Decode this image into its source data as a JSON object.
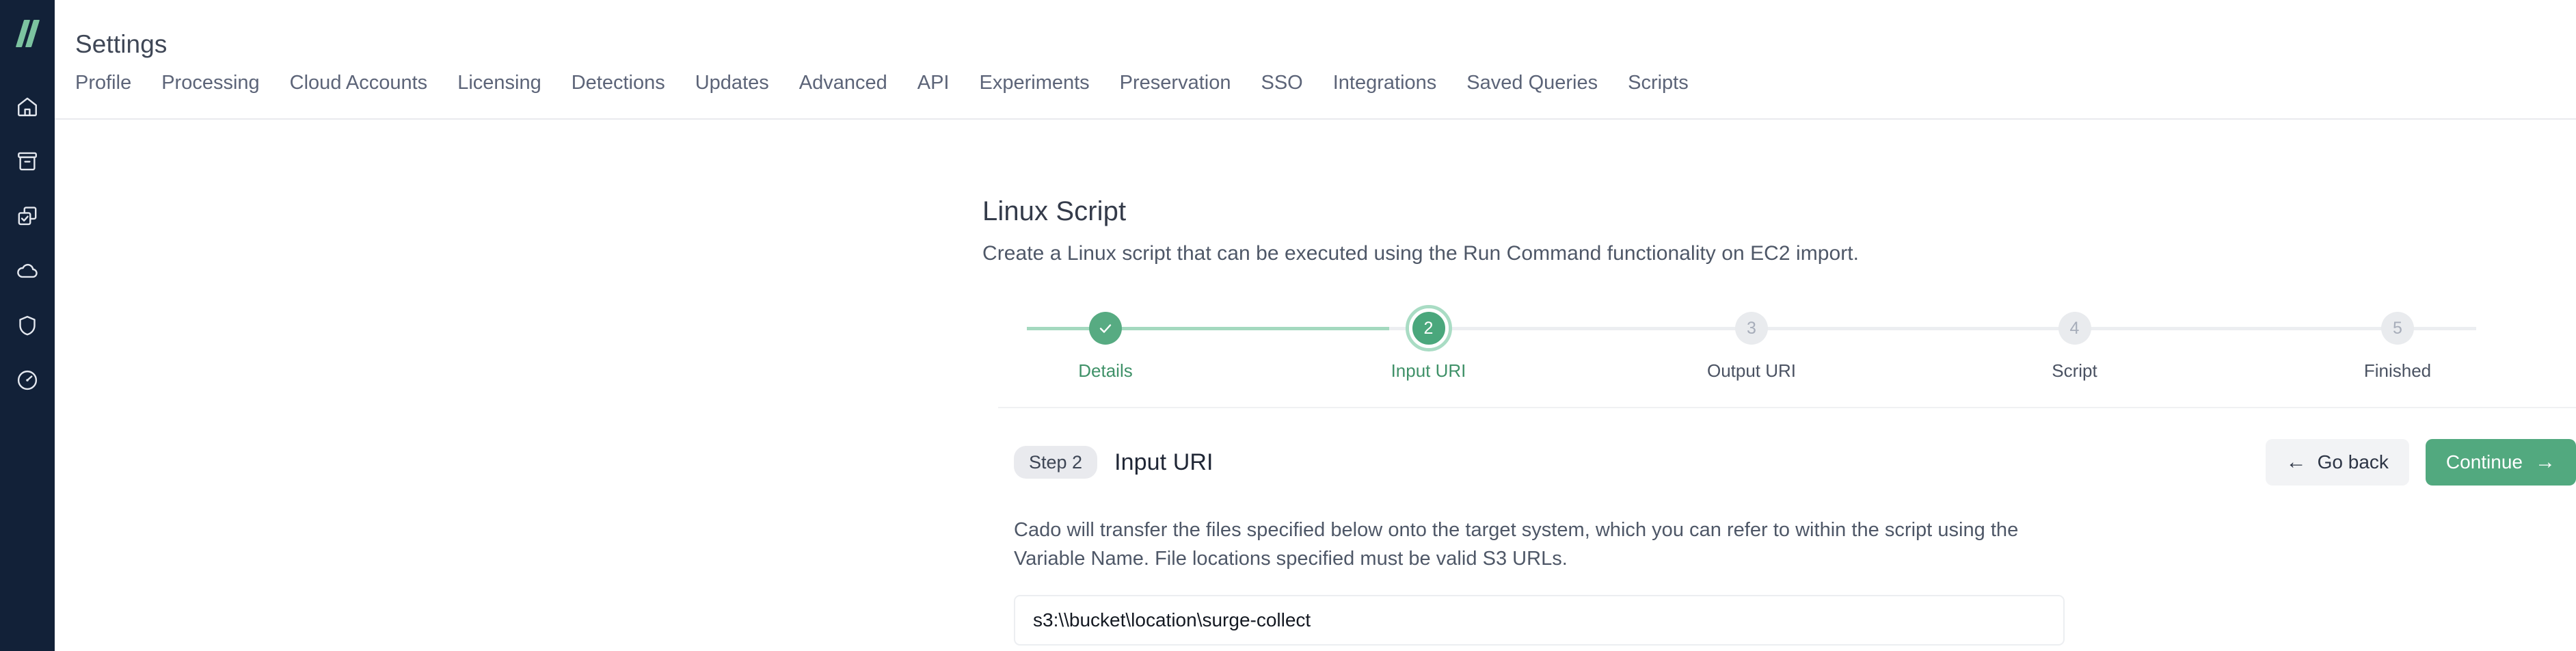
{
  "brand": {
    "logo_name": "cado-logo",
    "sidebar_bg": "#122138",
    "accent_green": "#7cc3a0",
    "primary_green": "#52a97f"
  },
  "sidebar": {
    "items": [
      {
        "icon": "home-icon",
        "name": "sidebar-item-home"
      },
      {
        "icon": "archive-icon",
        "name": "sidebar-item-archive"
      },
      {
        "icon": "tasks-icon",
        "name": "sidebar-item-tasks"
      },
      {
        "icon": "cloud-icon",
        "name": "sidebar-item-cloud"
      },
      {
        "icon": "shield-icon",
        "name": "sidebar-item-security"
      },
      {
        "icon": "speedometer-icon",
        "name": "sidebar-item-performance"
      }
    ]
  },
  "header": {
    "title": "Settings",
    "tabs": [
      {
        "label": "Profile"
      },
      {
        "label": "Processing"
      },
      {
        "label": "Cloud Accounts"
      },
      {
        "label": "Licensing"
      },
      {
        "label": "Detections"
      },
      {
        "label": "Updates"
      },
      {
        "label": "Advanced"
      },
      {
        "label": "API"
      },
      {
        "label": "Experiments"
      },
      {
        "label": "Preservation"
      },
      {
        "label": "SSO"
      },
      {
        "label": "Integrations"
      },
      {
        "label": "Saved Queries"
      },
      {
        "label": "Scripts"
      }
    ]
  },
  "main": {
    "title": "Linux Script",
    "subtitle": "Create a Linux script that can be executed using the Run Command functionality on EC2 import.",
    "stepper": {
      "current": 2,
      "steps": [
        {
          "number": "1",
          "label": "Details",
          "state": "done"
        },
        {
          "number": "2",
          "label": "Input URI",
          "state": "active"
        },
        {
          "number": "3",
          "label": "Output URI",
          "state": "todo"
        },
        {
          "number": "4",
          "label": "Script",
          "state": "todo"
        },
        {
          "number": "5",
          "label": "Finished",
          "state": "todo"
        }
      ]
    },
    "step_panel": {
      "pill": "Step 2",
      "heading": "Input URI",
      "go_back_label": "Go back",
      "go_back_arrow": "←",
      "continue_label": "Continue",
      "continue_arrow": "→",
      "body": "Cado will transfer the files specified below onto the target system, which you can refer to within the script using the Variable Name. File locations specified must be valid S3 URLs.",
      "input_value": "s3:\\\\bucket\\location\\surge-collect",
      "input_placeholder": ""
    }
  }
}
